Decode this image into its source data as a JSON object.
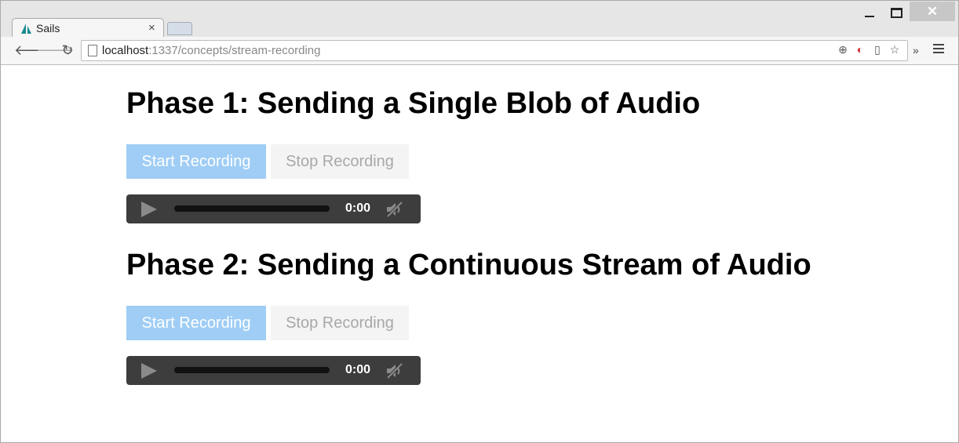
{
  "window": {
    "minimize_icon": "minimize-icon",
    "maximize_icon": "maximize-icon",
    "close_label": "✕"
  },
  "tabs": [
    {
      "title": "Sails",
      "close_label": "×"
    }
  ],
  "toolbar": {
    "url_host": "localhost",
    "url_rest": ":1337/concepts/stream-recording",
    "extensions_label": "»"
  },
  "sections": [
    {
      "heading": "Phase 1: Sending a Single Blob of Audio",
      "start_label": "Start Recording",
      "stop_label": "Stop Recording",
      "audio_time": "0:00"
    },
    {
      "heading": "Phase 2: Sending a Continuous Stream of Audio",
      "start_label": "Start Recording",
      "stop_label": "Stop Recording",
      "audio_time": "0:00"
    }
  ],
  "colors": {
    "start_button_bg": "#9fcdf5",
    "stop_button_bg": "#f4f4f4",
    "audio_bg": "#3d3d3d",
    "sails_logo": "#1a8a8f"
  }
}
